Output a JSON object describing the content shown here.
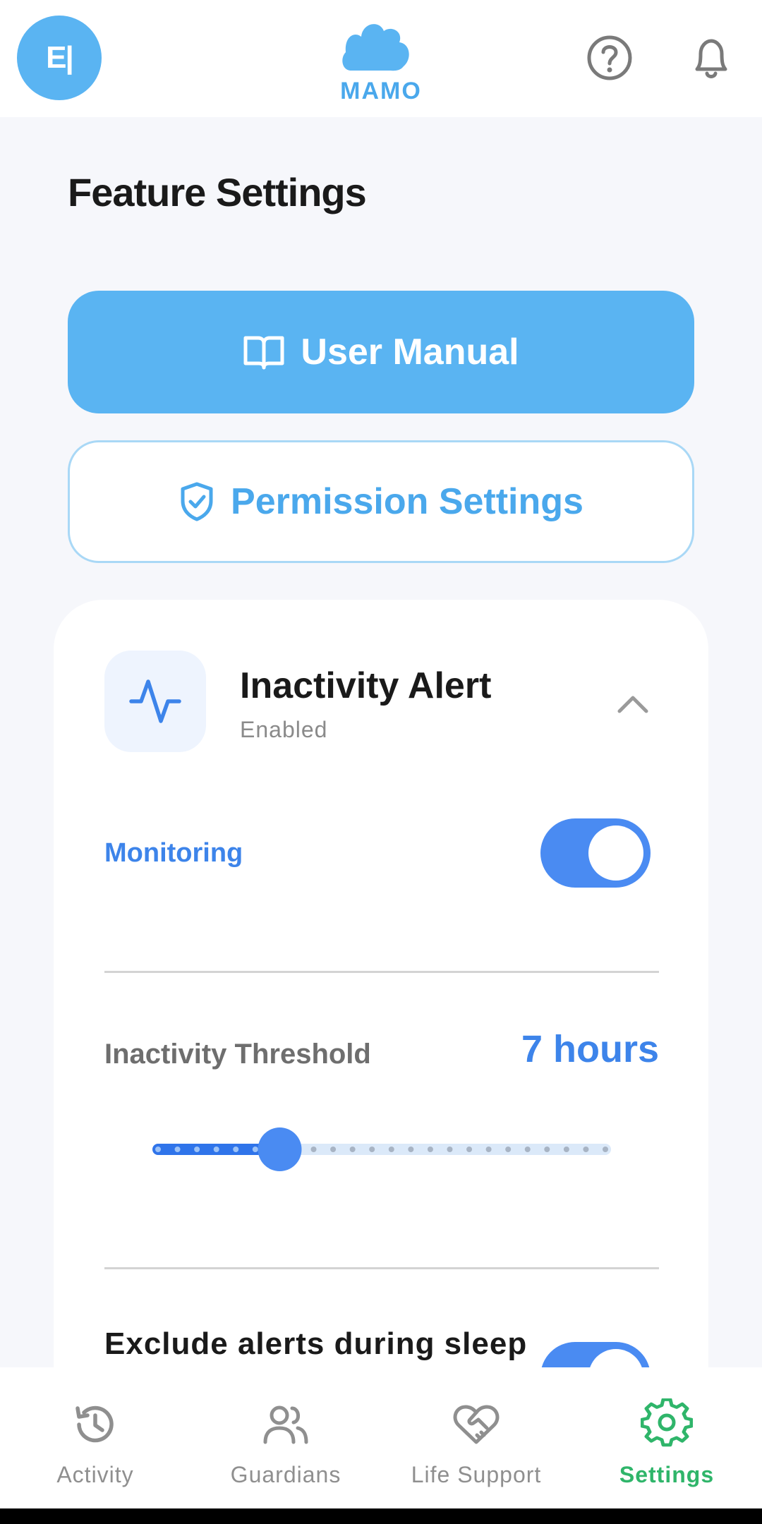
{
  "header": {
    "avatar_text": "E|",
    "logo_text": "MAMO",
    "help_icon": "help-circle-icon",
    "bell_icon": "bell-icon"
  },
  "page_title": "Feature Settings",
  "buttons": {
    "user_manual": "User Manual",
    "permission_settings": "Permission Settings"
  },
  "feature": {
    "title": "Inactivity Alert",
    "status": "Enabled",
    "icon": "activity-pulse-icon",
    "monitoring_label": "Monitoring",
    "monitoring_on": true,
    "threshold_label": "Inactivity Threshold",
    "threshold_value": "7 hours",
    "slider_position_fraction": 0.25,
    "exclude_label": "Exclude alerts during sleep",
    "exclude_on": true
  },
  "nav": {
    "items": [
      {
        "label": "Activity",
        "icon": "history-clock-icon"
      },
      {
        "label": "Guardians",
        "icon": "users-icon"
      },
      {
        "label": "Life Support",
        "icon": "heart-handshake-icon"
      },
      {
        "label": "Settings",
        "icon": "gear-icon"
      }
    ],
    "active": "Settings"
  },
  "colors": {
    "primary_blue": "#5ab4f2",
    "accent_blue": "#3d84ea",
    "toggle_blue": "#4a8bf2",
    "active_green": "#2fb56a"
  }
}
